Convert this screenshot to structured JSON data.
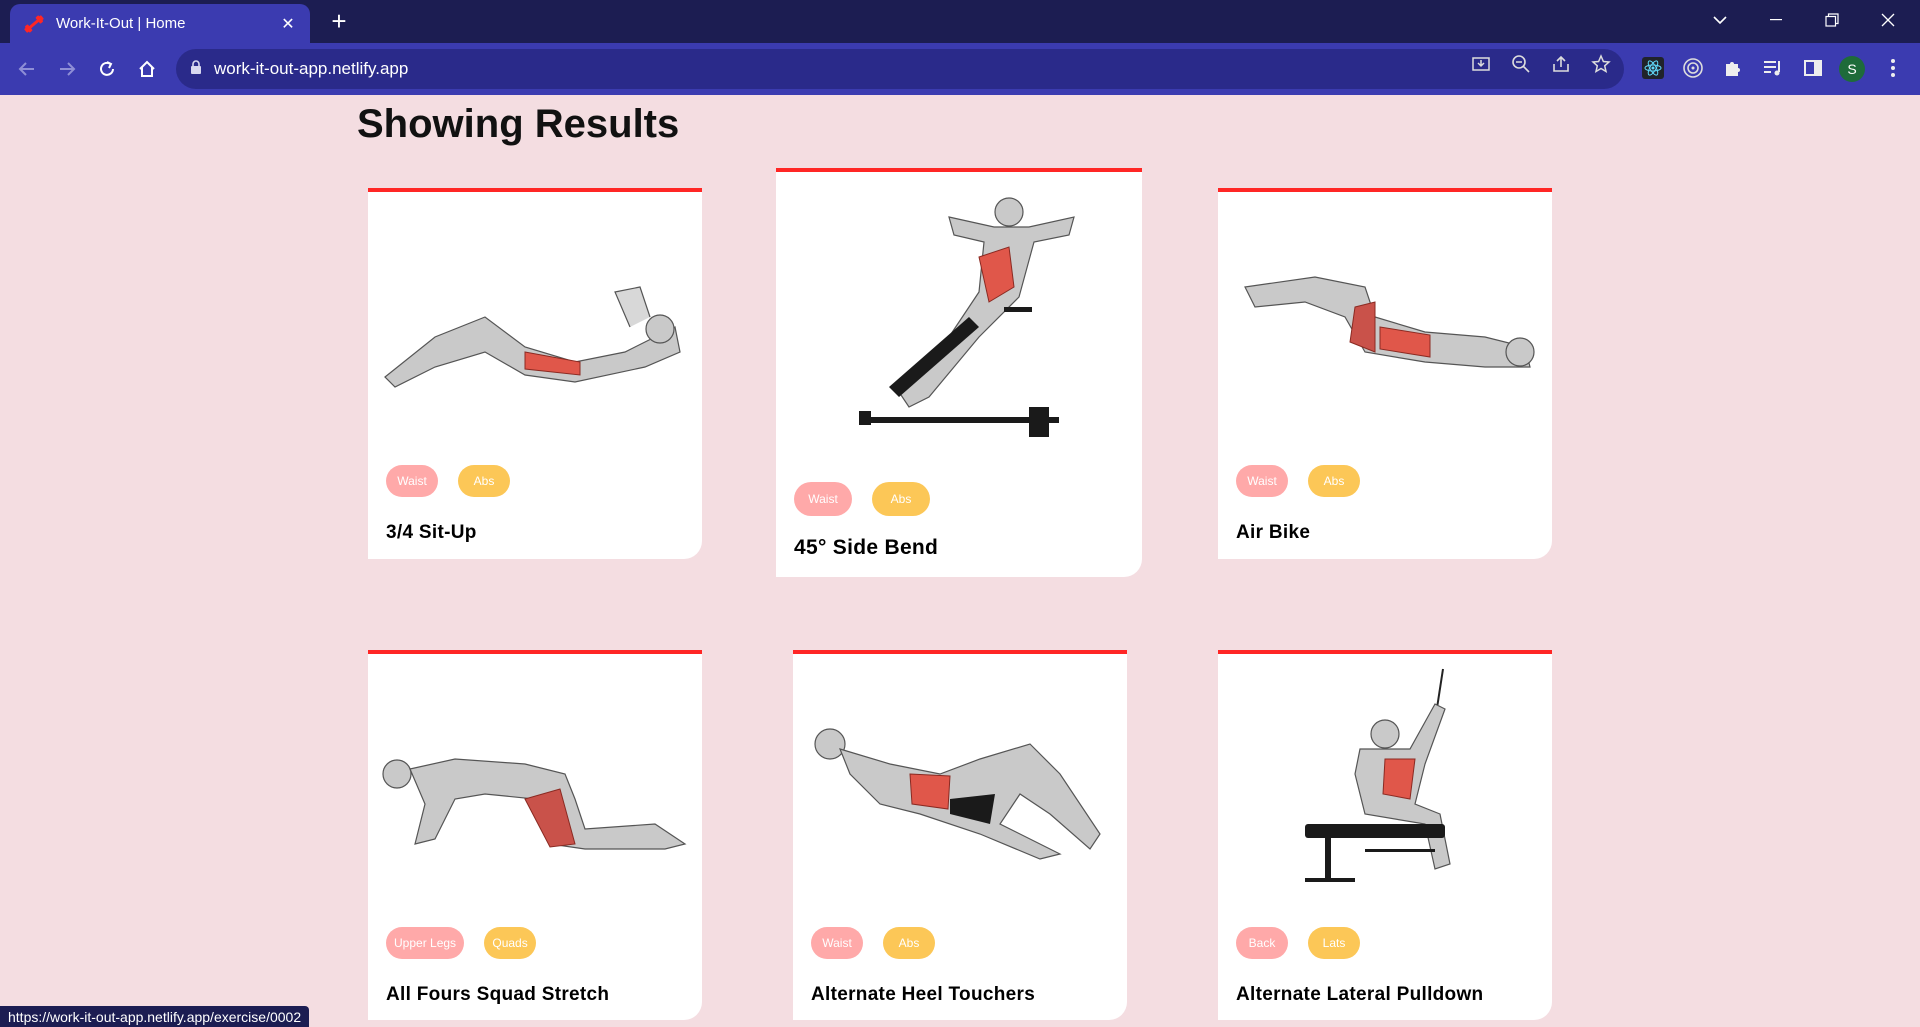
{
  "browser": {
    "tab_title": "Work-It-Out | Home",
    "url": "work-it-out-app.netlify.app",
    "status_url": "https://work-it-out-app.netlify.app/exercise/0002",
    "avatar_letter": "S",
    "colors": {
      "tabstrip": "#1c1d52",
      "toolbar": "#3b3bb0",
      "active_tab": "#3b3bb0"
    }
  },
  "page": {
    "heading": "Showing Results",
    "accent_color": "#ff2625",
    "background": "#f4dde1"
  },
  "exercises": [
    {
      "name": "3/4 Sit-Up",
      "body_part": "Waist",
      "target": "Abs",
      "figure": "situp-illustration"
    },
    {
      "name": "45° Side Bend",
      "body_part": "Waist",
      "target": "Abs",
      "figure": "side-bend-illustration"
    },
    {
      "name": "Air Bike",
      "body_part": "Waist",
      "target": "Abs",
      "figure": "air-bike-illustration"
    },
    {
      "name": "All Fours Squad Stretch",
      "body_part": "Upper Legs",
      "target": "Quads",
      "figure": "squad-stretch-illustration"
    },
    {
      "name": "Alternate Heel Touchers",
      "body_part": "Waist",
      "target": "Abs",
      "figure": "heel-touchers-illustration"
    },
    {
      "name": "Alternate Lateral Pulldown",
      "body_part": "Back",
      "target": "Lats",
      "figure": "lateral-pulldown-illustration"
    }
  ]
}
